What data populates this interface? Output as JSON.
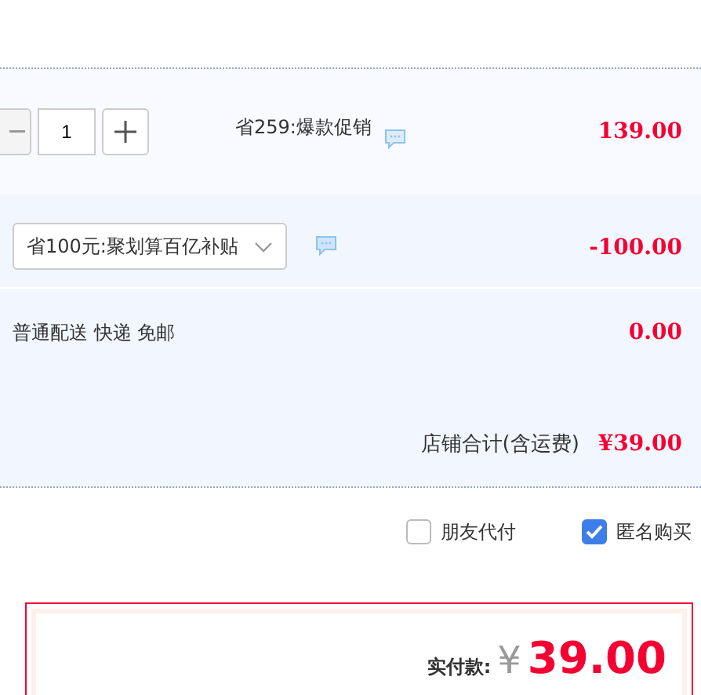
{
  "item": {
    "quantity": "1",
    "promo": "省259:爆款促销",
    "price": "139.00"
  },
  "discount": {
    "selected_option": "省100元:聚划算百亿补贴",
    "amount": "-100.00"
  },
  "shipping": {
    "label": "普通配送 快递 免邮",
    "amount": "0.00"
  },
  "store_total": {
    "label": "店铺合计(含运费)",
    "amount": "¥39.00"
  },
  "options": [
    {
      "label": "朋友代付",
      "checked": false
    },
    {
      "label": "匿名购买",
      "checked": true
    }
  ],
  "payment": {
    "label": "实付款:",
    "currency": "¥",
    "amount": "39.00"
  }
}
